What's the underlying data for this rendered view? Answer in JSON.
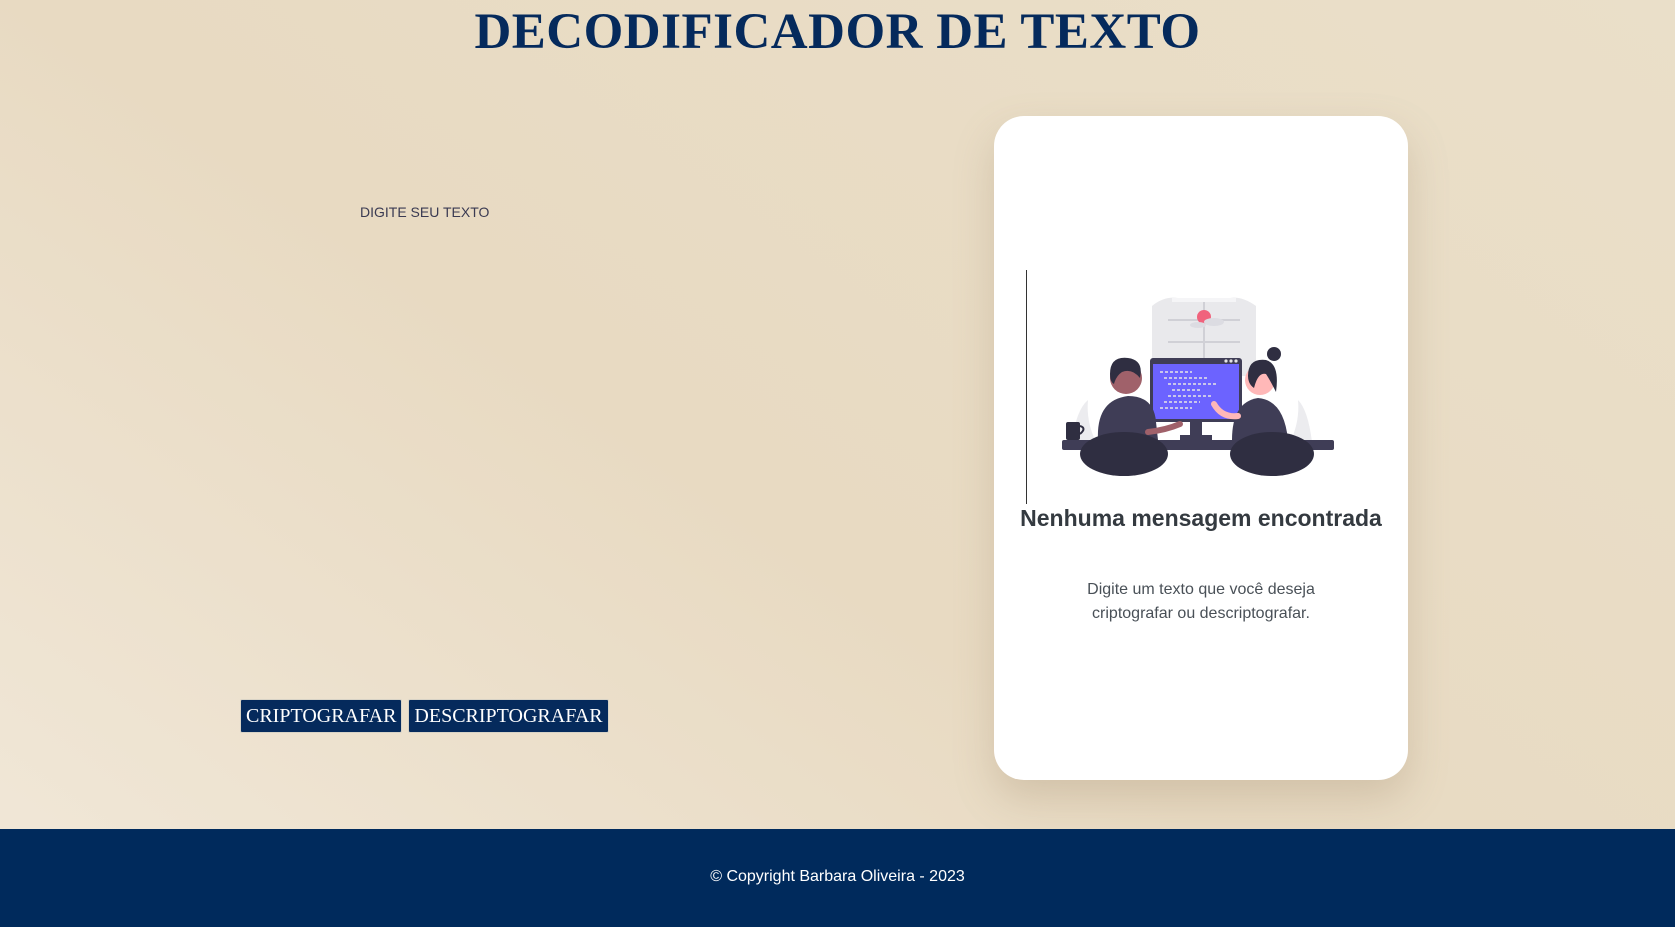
{
  "header": {
    "title": "DECODIFICADOR DE TEXTO"
  },
  "input": {
    "placeholder": "DIGITE SEU TEXTO",
    "value": ""
  },
  "buttons": {
    "encrypt_label": "CRIPTOGRAFAR",
    "decrypt_label": "DESCRIPTOGRAFAR"
  },
  "output_card": {
    "heading": "Nenhuma mensagem encontrada",
    "text": "Digite um texto que você deseja criptografar ou descriptografar."
  },
  "footer": {
    "copyright": "© Copyright Barbara Oliveira - 2023"
  },
  "colors": {
    "brand_navy": "#052a5c",
    "footer_bg": "#002a5c",
    "illustration_accent": "#6c63ff"
  }
}
